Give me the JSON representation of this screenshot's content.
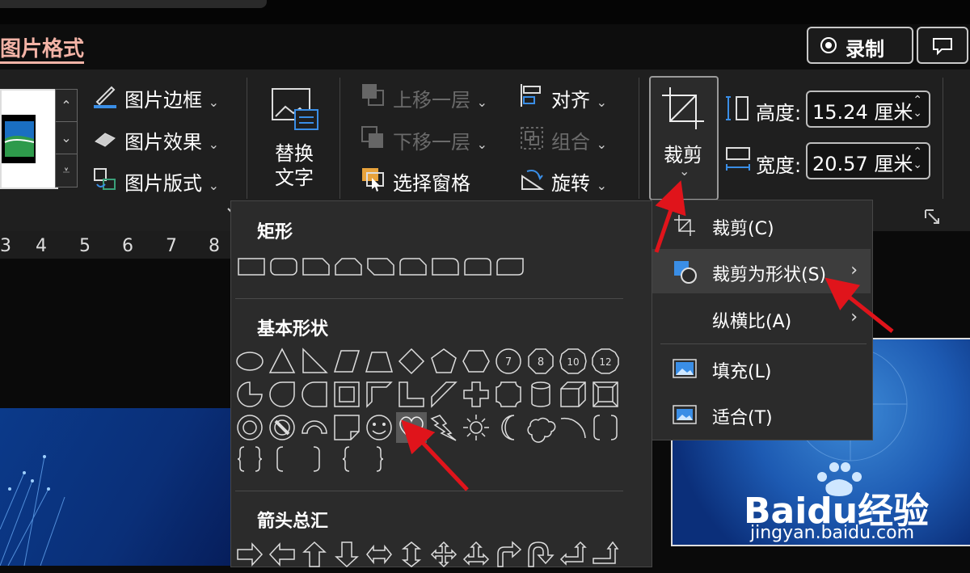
{
  "tab": {
    "active": "图片格式"
  },
  "header": {
    "record_label": "录制"
  },
  "ribbon": {
    "picture_border": "图片边框",
    "picture_effects": "图片效果",
    "picture_layout": "图片版式",
    "alt_text_line1": "替换",
    "alt_text_line2": "文字",
    "bring_forward": "上移一层",
    "send_backward": "下移一层",
    "selection_pane": "选择窗格",
    "align": "对齐",
    "group": "组合",
    "rotate": "旋转",
    "crop": "裁剪",
    "height_label": "高度:",
    "height_value": "15.24 厘米",
    "width_label": "宽度:",
    "width_value": "20.57 厘米"
  },
  "ruler": {
    "ticks": [
      "3",
      "4",
      "5",
      "6",
      "7",
      "8"
    ]
  },
  "shape_menu": {
    "sections": [
      "矩形",
      "基本形状",
      "箭头总汇"
    ],
    "highlighted": "heart"
  },
  "crop_menu": {
    "items": [
      {
        "label": "裁剪(C)",
        "icon": "crop-icon"
      },
      {
        "label": "裁剪为形状(S)",
        "icon": "crop-to-shape-icon",
        "submenu": true
      },
      {
        "label": "纵横比(A)",
        "icon": "",
        "submenu": true
      },
      {
        "label": "填充(L)",
        "icon": "fill-icon"
      },
      {
        "label": "适合(T)",
        "icon": "fit-icon"
      }
    ]
  },
  "watermark": {
    "brand": "Baidu经验",
    "url": "jingyan.baidu.com"
  }
}
